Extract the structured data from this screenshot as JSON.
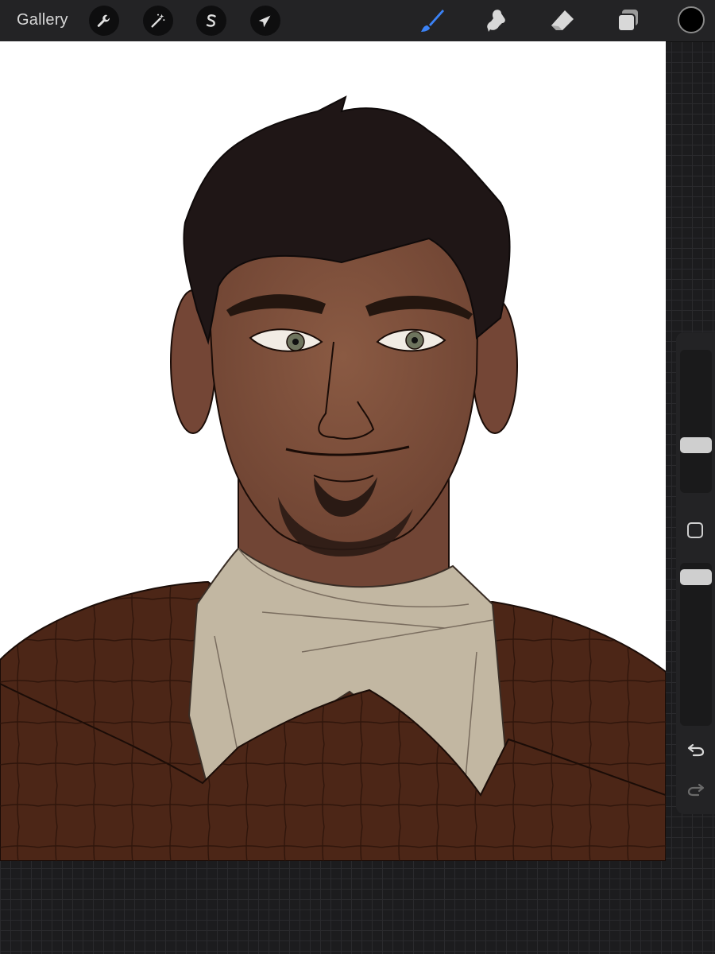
{
  "topbar": {
    "gallery_label": "Gallery",
    "advanced_tools": [
      {
        "name": "actions",
        "icon": "wrench-icon"
      },
      {
        "name": "adjustments",
        "icon": "magic-wand-icon"
      },
      {
        "name": "selection",
        "icon": "selection-s-icon"
      },
      {
        "name": "transform",
        "icon": "arrow-cursor-icon"
      }
    ],
    "painting_tools": [
      {
        "name": "brush",
        "icon": "brush-icon",
        "active": true
      },
      {
        "name": "smudge",
        "icon": "smudge-icon",
        "active": false
      },
      {
        "name": "eraser",
        "icon": "eraser-icon",
        "active": false
      },
      {
        "name": "layers",
        "icon": "layers-icon",
        "active": false
      }
    ],
    "current_color": "#000000"
  },
  "colors": {
    "active_tool": "#3b82f6",
    "ui_icon": "#d8d8d8",
    "canvas_background": "#ffffff"
  },
  "sidebar": {
    "brush_size_level": 0.55,
    "opacity_level": 1.0,
    "icons": [
      "modify-icon",
      "undo-icon",
      "redo-icon"
    ]
  }
}
